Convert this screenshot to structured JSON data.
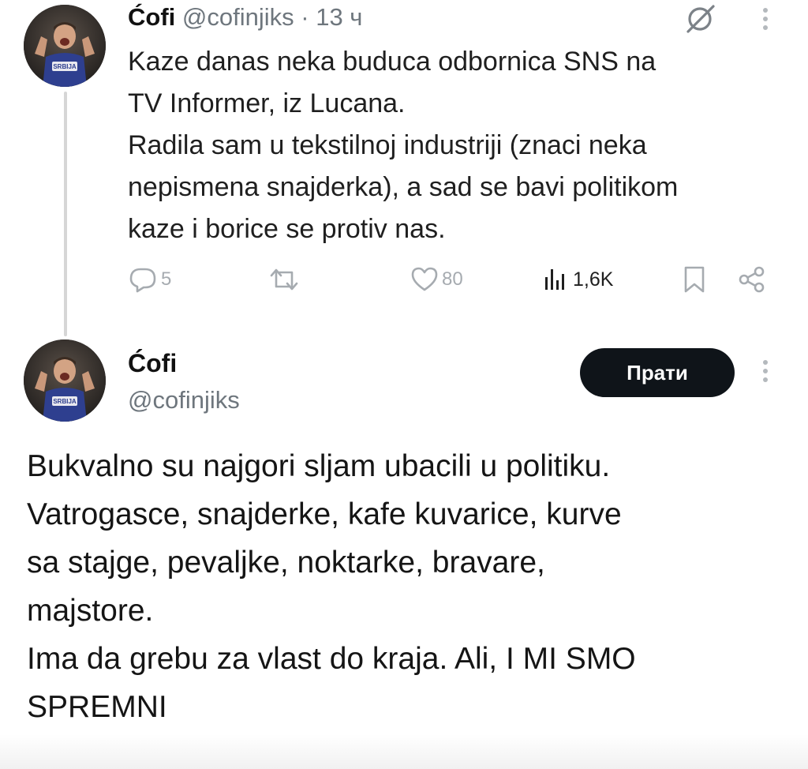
{
  "tweet1": {
    "display_name": "Ćofi",
    "handle": "@cofinjiks",
    "separator": "·",
    "time": "13 ч",
    "body_lines": [
      "Kaze danas neka buduca odbornica SNS na",
      "TV Informer, iz Lucana.",
      "Radila sam u tekstilnoj industriji (znaci neka",
      "nepismena snajderka), a sad se bavi politikom",
      "kaze i borice se protiv nas."
    ],
    "actions": {
      "replies": "5",
      "reposts": "",
      "likes": "80",
      "views": "1,6K"
    }
  },
  "tweet2": {
    "display_name": "Ćofi",
    "handle": "@cofinjiks",
    "follow_label": "Прати",
    "body_lines": [
      "Bukvalno su najgori sljam ubacili u politiku.",
      "Vatrogasce, snajderke, kafe kuvarice, kurve",
      "sa stajge, pevaljke, noktarke, bravare,",
      "majstore.",
      "Ima da grebu za vlast do kraja. Ali, I MI SMO",
      "SPREMNI"
    ]
  },
  "icons": {
    "grok": "grok-icon",
    "more": "more-vertical-icon",
    "reply": "reply-icon",
    "repost": "repost-icon",
    "like": "heart-icon",
    "views": "views-icon",
    "bookmark": "bookmark-icon",
    "share": "share-icon"
  },
  "colors": {
    "muted": "#6e767d",
    "action_gray": "#a6abb0",
    "button_bg": "#0f1419",
    "button_text": "#ffffff",
    "thread_line": "#d6d6d6"
  }
}
